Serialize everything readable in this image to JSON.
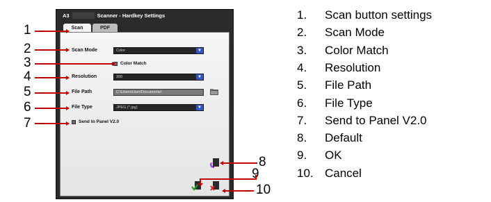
{
  "dialog": {
    "title_prefix": "A3",
    "title": "Scanner - Hardkey Settings",
    "tabs": [
      "Scan",
      "PDF"
    ],
    "scan_mode": {
      "label": "Scan Mode",
      "value": "Color"
    },
    "color_match": {
      "label": "Color Match"
    },
    "resolution": {
      "label": "Resolution",
      "value": "300"
    },
    "file_path": {
      "label": "File Path",
      "value": "C:\\Users\\User\\Documents\\"
    },
    "file_type": {
      "label": "File Type",
      "value": "JPEG (*.jpg)"
    },
    "send_to_panel": {
      "label": "Send to Panel V2.0"
    },
    "icons": {
      "browse": "folder-browse-icon",
      "default": "default-icon",
      "ok": "ok-icon",
      "cancel": "cancel-icon"
    }
  },
  "callouts": [
    "1",
    "2",
    "3",
    "4",
    "5",
    "6",
    "7",
    "8",
    "9",
    "10"
  ],
  "legend": [
    {
      "num": "1.",
      "text": "Scan button settings"
    },
    {
      "num": "2.",
      "text": "Scan Mode"
    },
    {
      "num": "3.",
      "text": "Color Match"
    },
    {
      "num": "4.",
      "text": "Resolution"
    },
    {
      "num": "5.",
      "text": "File Path"
    },
    {
      "num": "6.",
      "text": "File Type"
    },
    {
      "num": "7.",
      "text": "Send to Panel V2.0"
    },
    {
      "num": "8.",
      "text": "Default"
    },
    {
      "num": "9.",
      "text": "OK"
    },
    {
      "num": "10.",
      "text": "Cancel"
    }
  ],
  "colors": {
    "leader": "#c00000",
    "combo_arrow": "#2f59c7"
  }
}
